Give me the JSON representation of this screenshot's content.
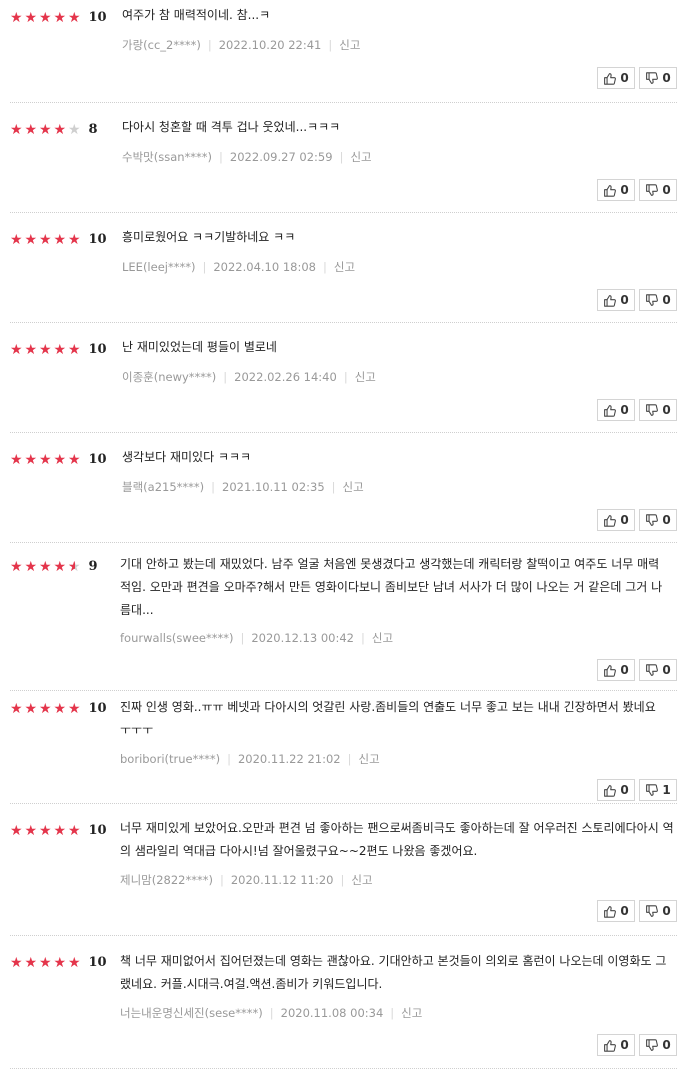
{
  "reviews": [
    {
      "stars": [
        1,
        1,
        1,
        1,
        1
      ],
      "score": "10",
      "text": "여주가 참 매력적이네. 참...ㅋ",
      "author": "가랑(cc_2****)",
      "date": "2022.10.20 22:41",
      "report": "신고",
      "likes": "0",
      "dislikes": "0"
    },
    {
      "stars": [
        1,
        1,
        1,
        1,
        0
      ],
      "score": "8",
      "text": "다아시 청혼할 때 격투 겁나 웃었네...ㅋㅋㅋ",
      "author": "수박맛(ssan****)",
      "date": "2022.09.27 02:59",
      "report": "신고",
      "likes": "0",
      "dislikes": "0"
    },
    {
      "stars": [
        1,
        1,
        1,
        1,
        1
      ],
      "score": "10",
      "text": "흥미로웠어요 ㅋㅋ기발하네요 ㅋㅋ",
      "author": "LEE(leej****)",
      "date": "2022.04.10 18:08",
      "report": "신고",
      "likes": "0",
      "dislikes": "0"
    },
    {
      "stars": [
        1,
        1,
        1,
        1,
        1
      ],
      "score": "10",
      "text": "난 재미있었는데 평들이 별로네",
      "author": "이종훈(newy****)",
      "date": "2022.02.26 14:40",
      "report": "신고",
      "likes": "0",
      "dislikes": "0"
    },
    {
      "stars": [
        1,
        1,
        1,
        1,
        1
      ],
      "score": "10",
      "text": "생각보다 재미있다 ㅋㅋㅋ",
      "author": "블랙(a215****)",
      "date": "2021.10.11 02:35",
      "report": "신고",
      "likes": "0",
      "dislikes": "0"
    },
    {
      "stars": [
        1,
        1,
        1,
        1,
        0.5
      ],
      "score": "9",
      "text": "기대 안하고 봤는데 재밌었다. 남주 얼굴 처음엔 못생겼다고 생각했는데 캐릭터랑 찰떡이고 여주도 너무 매력적임. 오만과 편견을 오마주?해서 만든 영화이다보니 좀비보단 남녀 서사가 더 많이 나오는 거 같은데 그거 나름대...",
      "author": "fourwalls(swee****)",
      "date": "2020.12.13 00:42",
      "report": "신고",
      "likes": "0",
      "dislikes": "0"
    },
    {
      "stars": [
        1,
        1,
        1,
        1,
        1
      ],
      "score": "10",
      "text": "진짜 인생 영화..ㅠㅠ 베넷과 다아시의 엇갈린 사랑.좀비들의 연출도 너무 좋고 보는 내내 긴장하면서 봤네요 ㅜㅜㅜ",
      "author": "boribori(true****)",
      "date": "2020.11.22 21:02",
      "report": "신고",
      "likes": "0",
      "dislikes": "1"
    },
    {
      "stars": [
        1,
        1,
        1,
        1,
        1
      ],
      "score": "10",
      "text": "너무 재미있게 보았어요.오만과 편견 넘 좋아하는 팬으로써좀비극도 좋아하는데 잘 어우러진 스토리에다아시 역의 샘라일리 역대급 다아시!넘 잘어울렸구요~~2편도 나왔음 좋겠어요.",
      "author": "제니맘(2822****)",
      "date": "2020.11.12 11:20",
      "report": "신고",
      "likes": "0",
      "dislikes": "0"
    },
    {
      "stars": [
        1,
        1,
        1,
        1,
        1
      ],
      "score": "10",
      "text": "책 너무 재미없어서 집어던졌는데 영화는 괜찮아요. 기대안하고 본것들이 의외로 홈런이 나오는데 이영화도 그랬네요. 커플.시대극.여걸.액션.좀비가 키워드입니다.",
      "author": "너는내운명신세진(sese****)",
      "date": "2020.11.08 00:34",
      "report": "신고",
      "likes": "0",
      "dislikes": "0"
    }
  ]
}
